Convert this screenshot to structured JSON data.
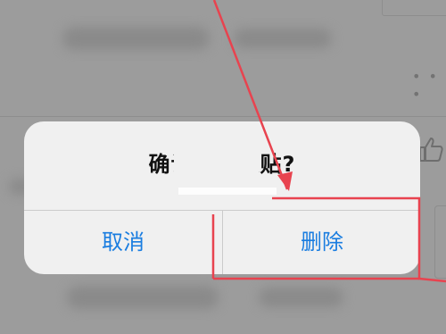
{
  "dialog": {
    "title": "确认删除跟贴?",
    "cancel_label": "取消",
    "delete_label": "删除"
  },
  "colors": {
    "accent": "#1a7de0",
    "annotation": "#e8434f"
  },
  "icons": [
    "more-icon",
    "thumbs-up-icon"
  ]
}
